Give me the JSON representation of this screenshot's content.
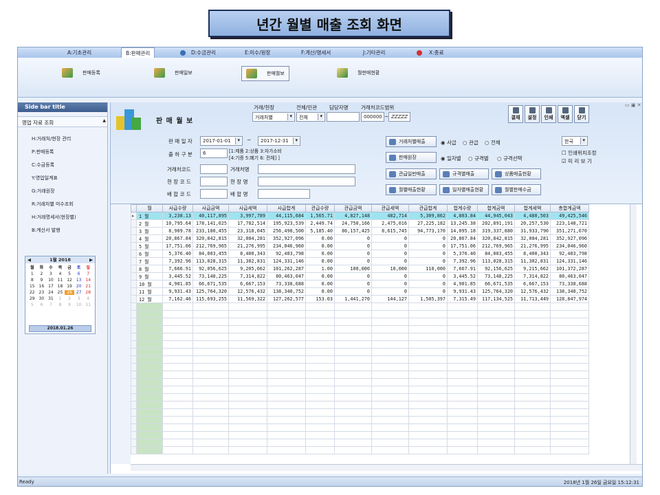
{
  "banner_title": "년간 월별 매출 조회 화면",
  "menu": [
    "A:기초관리",
    "B:판매관리",
    "D:수금관리",
    "E:미수/원장",
    "F:계산/명세서",
    "J:기타관리",
    "X:종료"
  ],
  "ribbon": [
    "판매등록",
    "판매일보",
    "판매월보",
    "월판매현황"
  ],
  "sidebar": {
    "title": "Side bar title",
    "section": "영업 자료 조회",
    "links": [
      "H:거래처/현장 관리",
      "P:판매등록",
      "C:수금등록",
      "Y:영업일계표",
      "G:거래원장",
      "R:거래처별 미수조회",
      "H:거래명세서(현장별)",
      "B:계산서 발행"
    ]
  },
  "calendar": {
    "month": "1월 2018",
    "weekdays": [
      "월",
      "화",
      "수",
      "목",
      "금",
      "토",
      "일"
    ],
    "days": [
      "1",
      "2",
      "3",
      "4",
      "5",
      "6",
      "7",
      "8",
      "9",
      "10",
      "11",
      "12",
      "13",
      "14",
      "15",
      "16",
      "17",
      "18",
      "19",
      "20",
      "21",
      "22",
      "23",
      "24",
      "25",
      "26",
      "27",
      "28",
      "29",
      "30",
      "31",
      "1",
      "2",
      "3",
      "4",
      "5",
      "6",
      "7",
      "8",
      "9",
      "10",
      "11"
    ],
    "extra_first": "1",
    "today": "2018.01.26"
  },
  "form": {
    "screen_title": "판 매 월 보",
    "filter_labels": [
      "거래/현장",
      "전체/민관",
      "담당자명",
      "거래처코드범위"
    ],
    "filter_values": [
      "거래처별",
      "전체",
      "",
      "000000",
      "ZZZZZ"
    ],
    "sales_period_label": "판 매 일 자",
    "date_from": "2017-01-01",
    "date_to": "2017-12-31",
    "tilde": "~",
    "output_type_label": "출 하 구 분",
    "output_type_value": "6",
    "output_note_1": "[1:제품 2:상품 3:자가소비",
    "output_note_2": "[4:기증 5:폐기 6: 전체] ]",
    "code_labels": [
      "거래처코드",
      "현 장 코 드",
      "배 합 코 드"
    ],
    "name_labels": [
      "거래처명",
      "현 장 명",
      "배 합 명"
    ],
    "btns_left": [
      "거래처별매출",
      "판매원장",
      "관급일반매출",
      "월별매출현황"
    ],
    "radio1": [
      "사급",
      "관급",
      "전체"
    ],
    "radio2": [
      "일자별",
      "규격별",
      "규격선택"
    ],
    "btns_row3": [
      "규격별매출",
      "상품매출현황"
    ],
    "btns_row4": [
      "일자별매출현황",
      "월별판매수금"
    ],
    "lang": "한국",
    "check1": "인쇄위치조정",
    "check2": "미 리 보 기",
    "tools": [
      "결재",
      "설정",
      "인쇄",
      "엑셀",
      "닫기"
    ]
  },
  "table": {
    "headers": [
      "월",
      "사급수량",
      "사급금액",
      "사급세액",
      "사급합계",
      "관급수량",
      "관급금액",
      "관급세액",
      "관급합계",
      "합계수량",
      "합계금액",
      "합계세액",
      "총합계금액"
    ],
    "rows": [
      [
        "1 월",
        "3,238.13",
        "40,117,895",
        "3,997,789",
        "44,115,684",
        "1,565.71",
        "4,827,148",
        "482,714",
        "5,309,862",
        "4,803.84",
        "44,945,043",
        "4,480,503",
        "49,425,546"
      ],
      [
        "2 월",
        "10,795.64",
        "178,141,025",
        "17,782,514",
        "195,923,539",
        "2,449.74",
        "24,750,166",
        "2,475,016",
        "27,225,182",
        "13,245.38",
        "202,891,191",
        "20,257,530",
        "223,148,721"
      ],
      [
        "3 월",
        "8,909.78",
        "233,180,455",
        "23,318,045",
        "256,498,500",
        "5,185.40",
        "86,157,425",
        "8,615,745",
        "94,773,170",
        "14,095.18",
        "319,337,880",
        "31,933,790",
        "351,271,670"
      ],
      [
        "4 월",
        "20,867.84",
        "320,842,815",
        "32,084,281",
        "352,927,096",
        "0.00",
        "0",
        "0",
        "0",
        "20,867.84",
        "320,842,815",
        "32,084,281",
        "352,927,096"
      ],
      [
        "5 월",
        "17,751.06",
        "212,769,965",
        "21,276,995",
        "234,046,960",
        "0.00",
        "0",
        "0",
        "0",
        "17,751.06",
        "212,769,965",
        "21,276,995",
        "234,046,960"
      ],
      [
        "6 월",
        "5,376.40",
        "84,003,455",
        "8,400,343",
        "92,403,798",
        "0.00",
        "0",
        "0",
        "0",
        "5,376.40",
        "84,003,455",
        "8,400,343",
        "92,403,798"
      ],
      [
        "7 월",
        "7,392.96",
        "113,028,315",
        "11,302,831",
        "124,331,146",
        "0.00",
        "0",
        "0",
        "0",
        "7,392.96",
        "113,028,315",
        "11,302,831",
        "124,331,146"
      ],
      [
        "8 월",
        "7,666.91",
        "92,056,625",
        "9,205,662",
        "101,262,287",
        "1.00",
        "100,000",
        "10,000",
        "110,000",
        "7,667.91",
        "92,156,625",
        "9,215,662",
        "101,372,287"
      ],
      [
        "9 월",
        "3,445.52",
        "73,148,225",
        "7,314,822",
        "80,463,047",
        "0.00",
        "0",
        "0",
        "0",
        "3,445.52",
        "73,148,225",
        "7,314,822",
        "80,463,047"
      ],
      [
        "10 월",
        "4,901.85",
        "66,671,535",
        "6,667,153",
        "73,338,688",
        "0.00",
        "0",
        "0",
        "0",
        "4,901.85",
        "66,671,535",
        "6,667,153",
        "73,338,688"
      ],
      [
        "11 월",
        "9,931.43",
        "125,764,320",
        "12,576,432",
        "138,340,752",
        "0.00",
        "0",
        "0",
        "0",
        "9,931.43",
        "125,764,320",
        "12,576,432",
        "138,340,752"
      ],
      [
        "12 월",
        "7,162.46",
        "115,693,255",
        "11,569,322",
        "127,262,577",
        "153.03",
        "1,441,270",
        "144,127",
        "1,585,397",
        "7,315.49",
        "117,134,525",
        "11,713,449",
        "128,847,974"
      ]
    ]
  },
  "status": {
    "left": "Ready",
    "right": "2018년 1월 26일 금요일 15:12:31"
  }
}
